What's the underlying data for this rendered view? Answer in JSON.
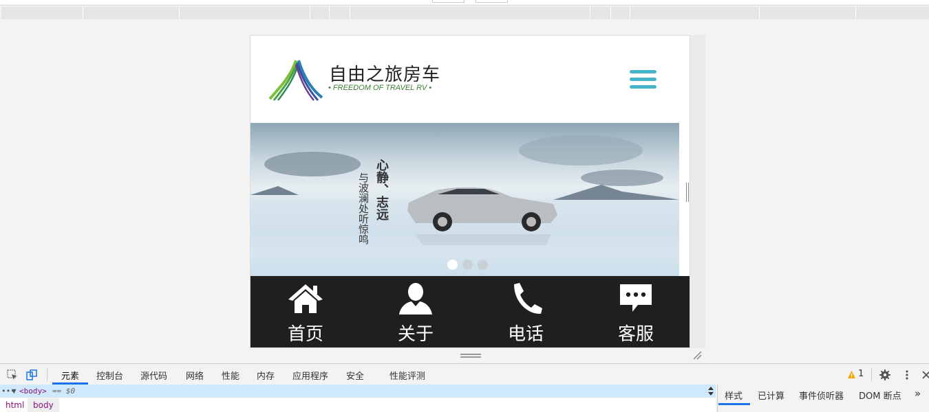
{
  "site": {
    "logo_title": "自由之旅房车",
    "logo_subtitle": "• FREEDOM OF TRAVEL RV •",
    "banner": {
      "slogan_main": "心静、志远",
      "slogan_sub": "与波澜处听惊鸣",
      "slides_count": 3,
      "active_slide": 1
    },
    "nav": [
      {
        "label": "首页",
        "icon": "home-icon"
      },
      {
        "label": "关于",
        "icon": "person-icon"
      },
      {
        "label": "电话",
        "icon": "phone-icon"
      },
      {
        "label": "客服",
        "icon": "chat-icon"
      }
    ],
    "colors": {
      "menu": "#45b4c9",
      "nav_bg": "#1f1f1f"
    }
  },
  "devtools": {
    "tabs": [
      "元素",
      "控制台",
      "源代码",
      "网络",
      "性能",
      "内存",
      "应用程序",
      "安全",
      "性能评测"
    ],
    "active_tab": "元素",
    "warning_count": "1",
    "selected_node": "<body>",
    "selected_suffix": "== $0",
    "breadcrumbs": [
      "html",
      "body"
    ],
    "side_tabs": [
      "样式",
      "已计算",
      "事件侦听器",
      "DOM 断点"
    ],
    "more": "»"
  }
}
